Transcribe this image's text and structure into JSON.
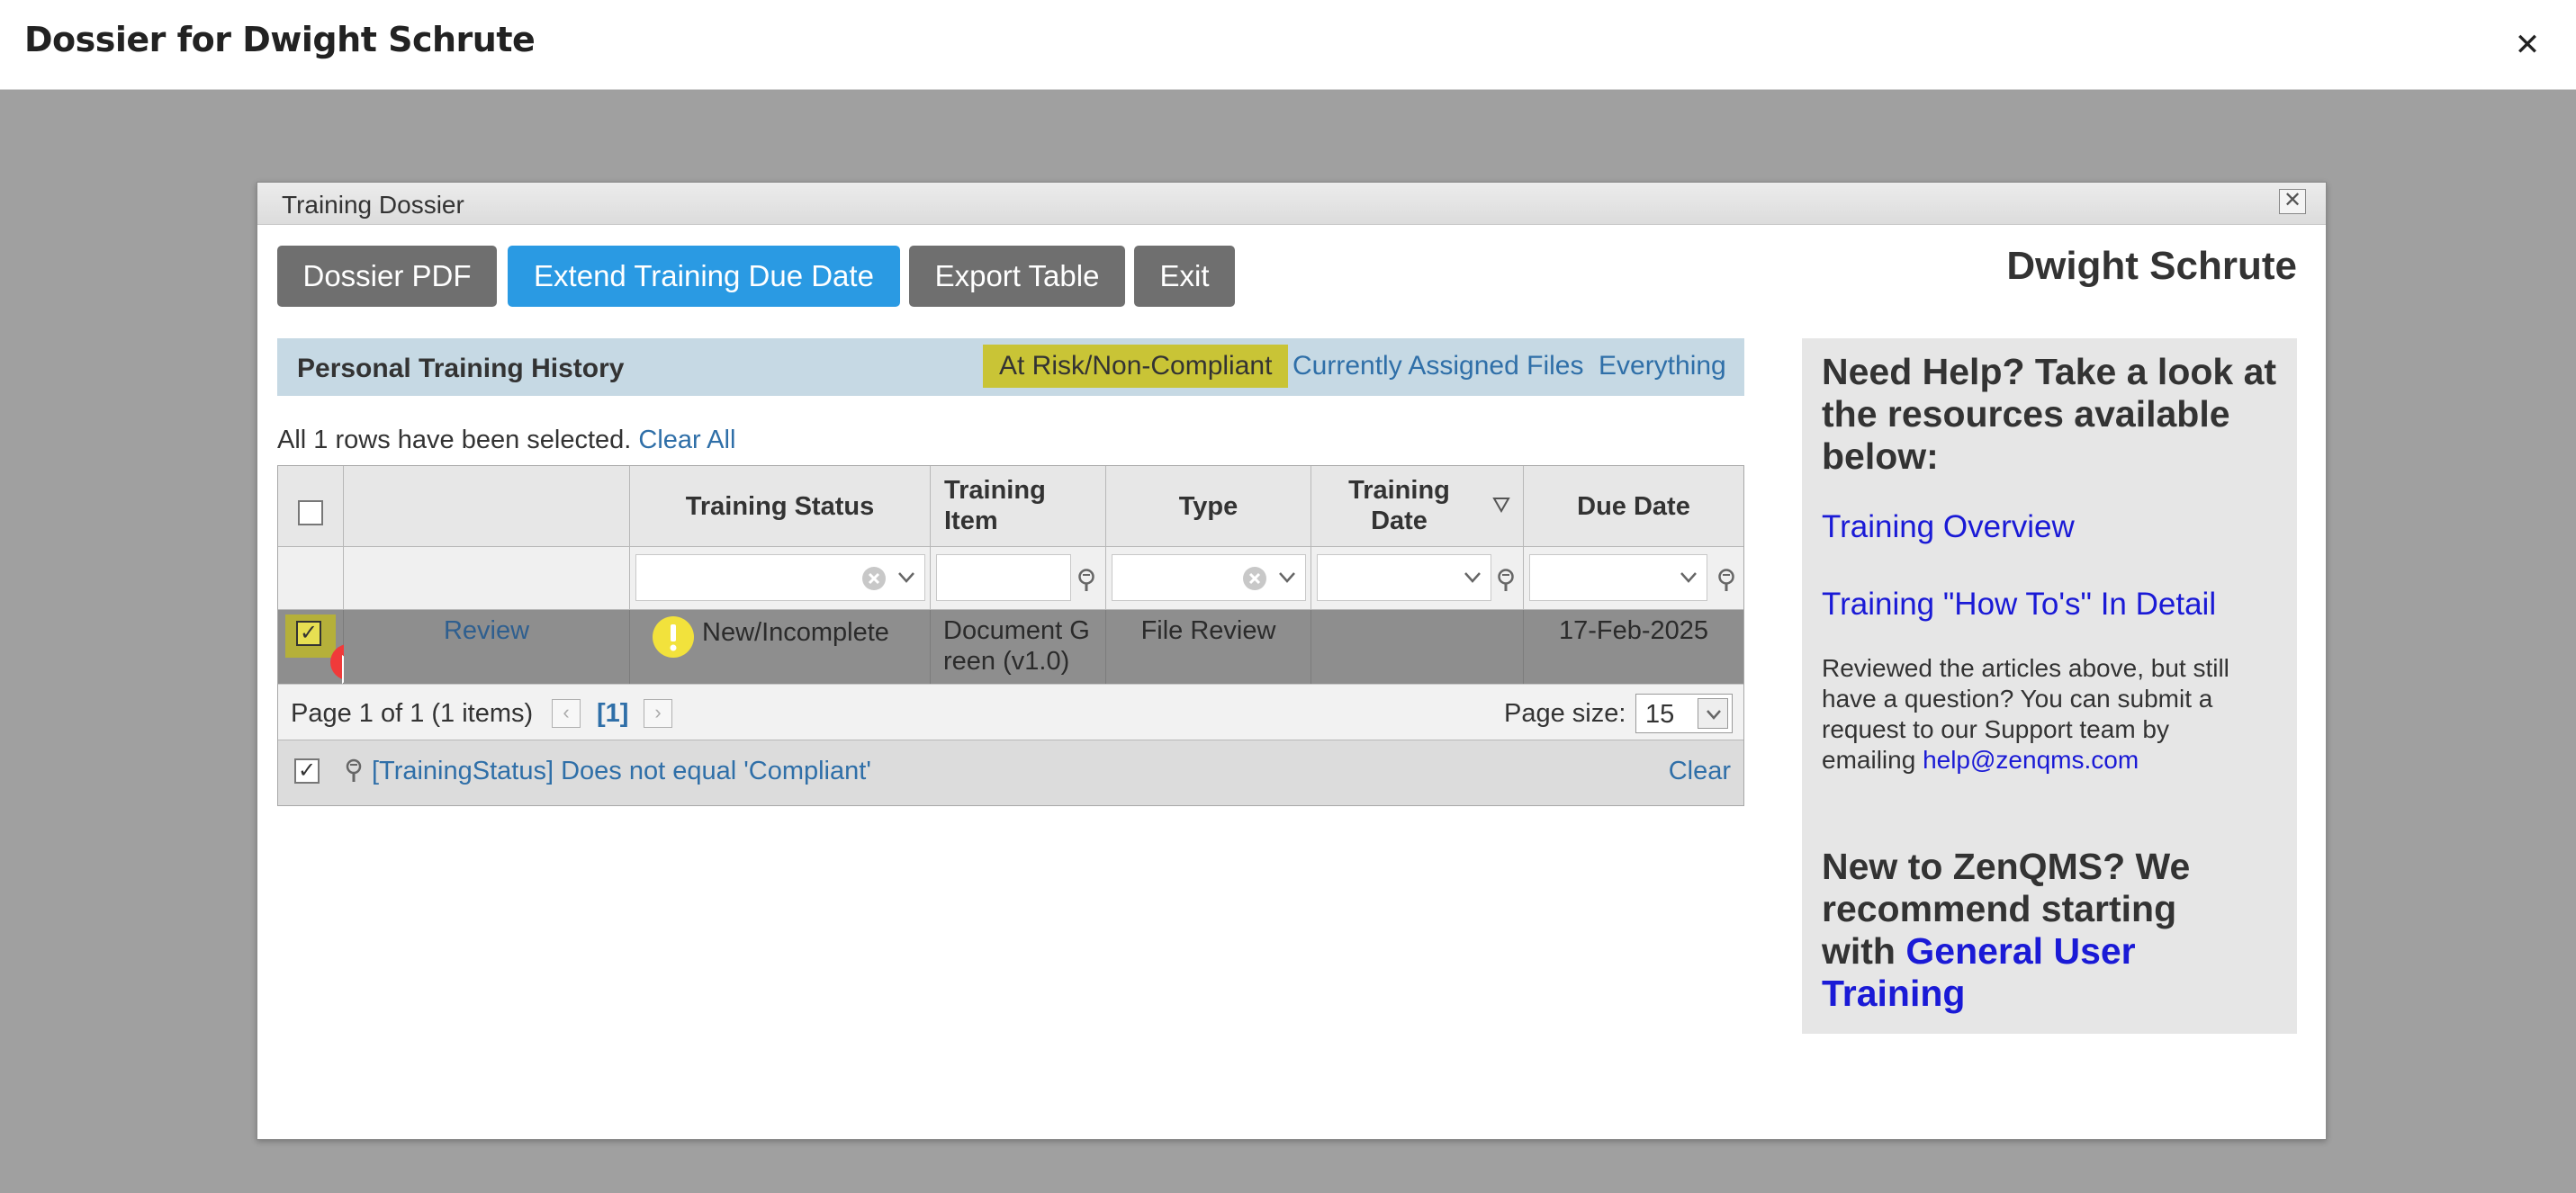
{
  "page": {
    "title": "Dossier for Dwight  Schrute",
    "close_glyph": "✕"
  },
  "dialog": {
    "title": "Training Dossier",
    "close_glyph": "✕",
    "user_name": "Dwight Schrute",
    "buttons": {
      "pdf": "Dossier PDF",
      "extend": "Extend Training Due Date",
      "export": "Export Table",
      "exit": "Exit"
    }
  },
  "history": {
    "title": "Personal Training History",
    "tabs": [
      "At Risk/Non-Compliant",
      "Currently Assigned Files",
      "Everything"
    ],
    "selection_text": "All 1 rows have been selected.",
    "clear_all": "Clear All"
  },
  "grid": {
    "columns": {
      "status": "Training Status",
      "item_1": "Training",
      "item_2": "Item",
      "type": "Type",
      "date_1": "Training",
      "date_2": "Date",
      "due": "Due Date"
    },
    "row": {
      "action": "Review",
      "status": "New/Incomplete",
      "item_1": "Document G",
      "item_2": "reen (v1.0)",
      "type": "File Review",
      "training_date": "",
      "due": "17-Feb-2025"
    },
    "pager": {
      "info": "Page 1 of 1 (1 items)",
      "current": "[1]",
      "size_label": "Page size:",
      "size_value": "15"
    },
    "filter_expression": "[TrainingStatus] Does not equal 'Compliant'",
    "filter_clear": "Clear"
  },
  "help": {
    "heading": [
      "Need Help? Take a look at",
      "the resources available",
      "below:"
    ],
    "link_overview": "Training Overview",
    "link_howto": "Training \"How To's\" In Detail",
    "para": [
      "Reviewed the articles above, but still",
      "have a question? You can submit a",
      "request to our Support team by",
      "emailing "
    ],
    "email": "help@zenqms.com",
    "new_heading": [
      "New to ZenQMS? We",
      "recommend starting",
      "with "
    ],
    "new_link_1": "General User",
    "new_link_2": "Training"
  },
  "colors": {
    "accent_blue": "#2a9ae3",
    "active_tab": "#c9c436",
    "link": "#2f6fa8",
    "help_link": "#1a1ad6"
  }
}
